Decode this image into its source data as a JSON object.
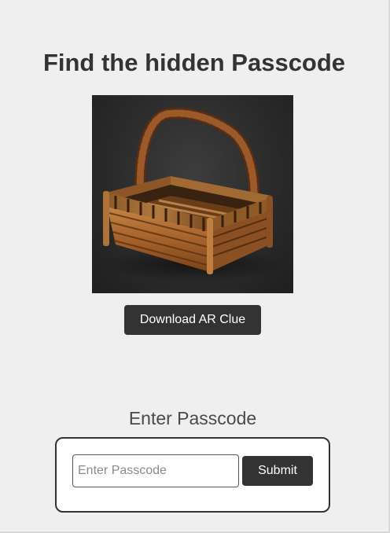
{
  "page": {
    "title": "Find the hidden Passcode",
    "background_color": "#efefef"
  },
  "clue": {
    "image_icon": "wicker-basket-image",
    "download_label": "Download AR Clue"
  },
  "passcode": {
    "heading": "Enter Passcode",
    "input_value": "",
    "input_placeholder": "Enter Passcode",
    "submit_label": "Submit"
  },
  "colors": {
    "button": "#333333",
    "button_text": "#ffffff",
    "text": "#333333"
  }
}
